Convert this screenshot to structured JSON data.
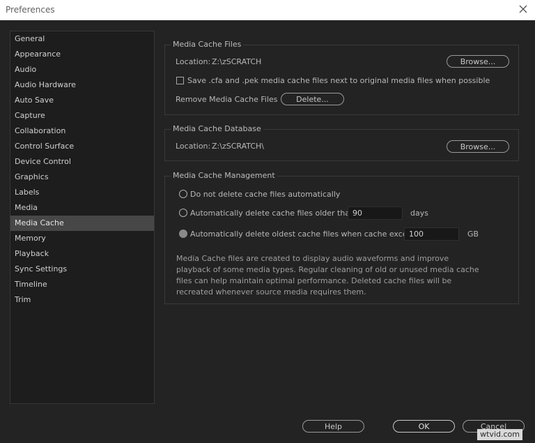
{
  "window": {
    "title": "Preferences"
  },
  "sidebar": {
    "items": [
      {
        "label": "General"
      },
      {
        "label": "Appearance"
      },
      {
        "label": "Audio"
      },
      {
        "label": "Audio Hardware"
      },
      {
        "label": "Auto Save"
      },
      {
        "label": "Capture"
      },
      {
        "label": "Collaboration"
      },
      {
        "label": "Control Surface"
      },
      {
        "label": "Device Control"
      },
      {
        "label": "Graphics"
      },
      {
        "label": "Labels"
      },
      {
        "label": "Media"
      },
      {
        "label": "Media Cache"
      },
      {
        "label": "Memory"
      },
      {
        "label": "Playback"
      },
      {
        "label": "Sync Settings"
      },
      {
        "label": "Timeline"
      },
      {
        "label": "Trim"
      }
    ],
    "selected": "Media Cache"
  },
  "media_cache_files": {
    "title": "Media Cache Files",
    "location_label": "Location:",
    "location_value": "Z:\\zSCRATCH",
    "browse_label": "Browse...",
    "save_checkbox_label": "Save .cfa and .pek media cache files next to original media files when possible",
    "save_checked": false,
    "remove_label": "Remove Media Cache Files",
    "delete_label": "Delete..."
  },
  "media_cache_database": {
    "title": "Media Cache Database",
    "location_label": "Location:",
    "location_value": "Z:\\zSCRATCH\\",
    "browse_label": "Browse..."
  },
  "media_cache_management": {
    "title": "Media Cache Management",
    "option_none": "Do not delete cache files automatically",
    "option_older": "Automatically delete cache files older than:",
    "older_value": "90",
    "older_unit": "days",
    "option_exceeds": "Automatically delete oldest cache files when cache exceeds:",
    "exceeds_value": "100",
    "exceeds_unit": "GB",
    "selected_option": "option_exceeds",
    "description": "Media Cache files are created to display audio waveforms and improve playback of some media types.  Regular cleaning of old or unused media cache files can help maintain optimal performance. Deleted cache files will be recreated whenever source media requires them."
  },
  "footer": {
    "help_label": "Help",
    "ok_label": "OK",
    "cancel_label": "Cancel"
  },
  "watermark": "wtvid.com"
}
